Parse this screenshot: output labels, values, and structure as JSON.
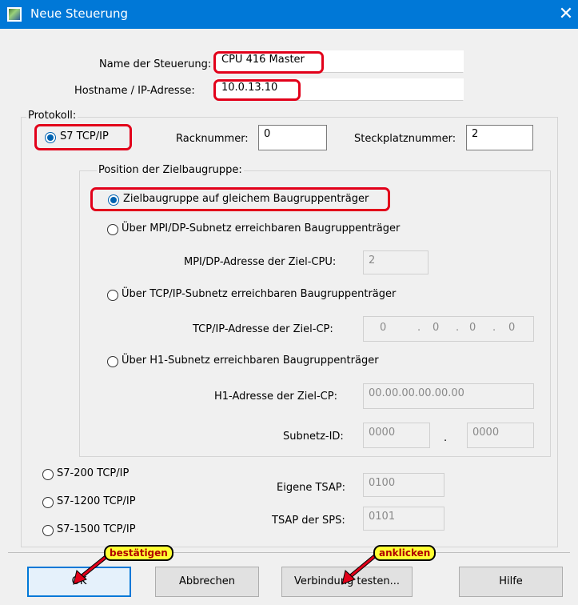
{
  "window": {
    "title": "Neue Steuerung",
    "close_glyph": "✕"
  },
  "form": {
    "name_label": "Name der Steuerung:",
    "name_value": "CPU 416 Master",
    "host_label": "Hostname / IP-Adresse:",
    "host_value": "10.0.13.10"
  },
  "protocol": {
    "group_label": "Protokoll:",
    "s7tcp_label": "S7 TCP/IP",
    "rack_label": "Racknummer:",
    "rack_value": "0",
    "slot_label": "Steckplatznummer:",
    "slot_value": "2",
    "s7_200_label": "S7-200 TCP/IP",
    "s7_1200_label": "S7-1200 TCP/IP",
    "s7_1500_label": "S7-1500 TCP/IP",
    "own_tsap_label": "Eigene TSAP:",
    "own_tsap_value": "0100",
    "plc_tsap_label": "TSAP der SPS:",
    "plc_tsap_value": "0101"
  },
  "target": {
    "group_label": "Position der Zielbaugruppe:",
    "same_rack_label": "Zielbaugruppe auf gleichem Baugruppenträger",
    "mpi_label": "Über MPI/DP-Subnetz erreichbaren Baugruppenträger",
    "mpi_addr_label": "MPI/DP-Adresse der Ziel-CPU:",
    "mpi_addr_value": "2",
    "tcp_label": "Über TCP/IP-Subnetz erreichbaren Baugruppenträger",
    "tcp_addr_label": "TCP/IP-Adresse der Ziel-CP:",
    "ip_octets": [
      "0",
      "0",
      "0",
      "0"
    ],
    "ip_dot": ".",
    "h1_label": "Über H1-Subnetz erreichbaren Baugruppenträger",
    "h1_addr_label": "H1-Adresse der Ziel-CP:",
    "h1_addr_value": "00.00.00.00.00.00",
    "subnet_label": "Subnetz-ID:",
    "subnet_value1": "0000",
    "subnet_sep": ".",
    "subnet_value2": "0000"
  },
  "buttons": {
    "ok": "OK",
    "cancel": "Abbrechen",
    "test": "Verbindung testen...",
    "help": "Hilfe"
  },
  "annotations": {
    "confirm": "bestätigen",
    "click": "anklicken",
    "highlight_color": "#e2001a",
    "callout_color": "#ffff33"
  },
  "selection": {
    "protocol": "S7 TCP/IP",
    "target_position": "Zielbaugruppe auf gleichem Baugruppenträger"
  }
}
